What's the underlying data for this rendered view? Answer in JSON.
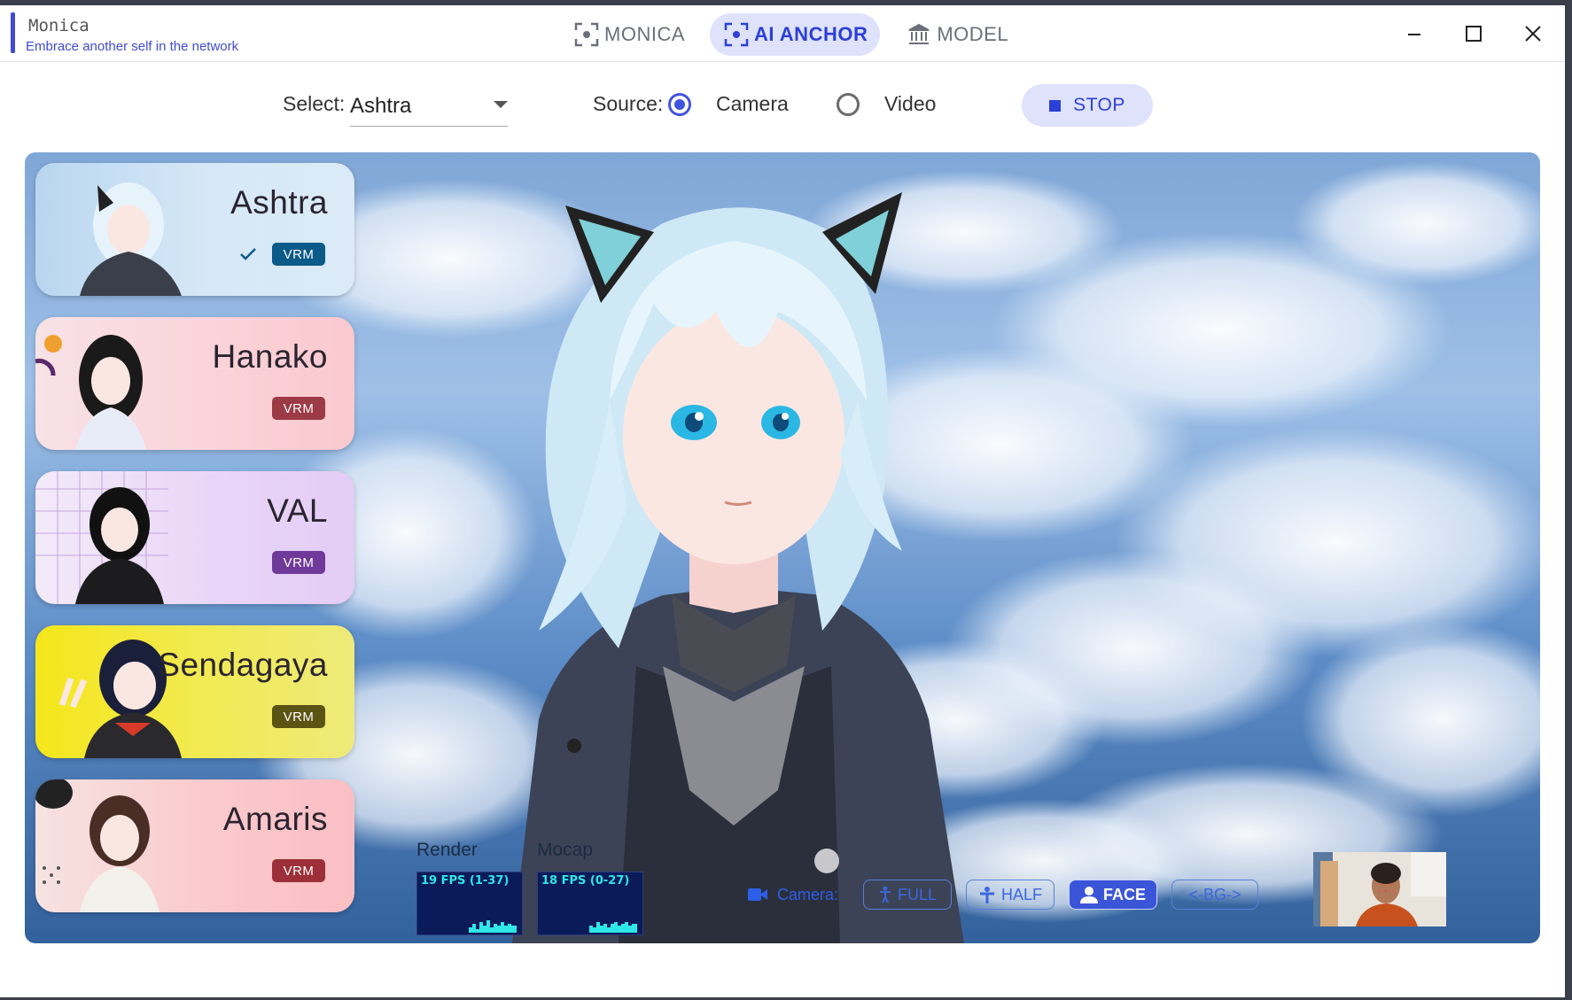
{
  "app": {
    "name": "Monica",
    "tagline": "Embrace another self in the network",
    "accent_color": "#3f4ccf"
  },
  "nav": {
    "tabs": [
      {
        "label": "MONICA",
        "icon": "focus-frame-icon",
        "active": false
      },
      {
        "label": "AI ANCHOR",
        "icon": "focus-frame-icon",
        "active": true
      },
      {
        "label": "MODEL",
        "icon": "bank-icon",
        "active": false
      }
    ]
  },
  "window_controls": {
    "minimize": "minimize-icon",
    "maximize": "maximize-icon",
    "close": "close-icon"
  },
  "toolbar": {
    "select_label": "Select:",
    "select_value": "Ashtra",
    "source_label": "Source:",
    "source_options": [
      {
        "label": "Camera",
        "checked": true
      },
      {
        "label": "Video",
        "checked": false
      }
    ],
    "stop_label": "STOP"
  },
  "models": [
    {
      "name": "Ashtra",
      "badge": "VRM",
      "selected": true,
      "card_color": "#cfe4f6",
      "badge_color": "#0a5a8a"
    },
    {
      "name": "Hanako",
      "badge": "VRM",
      "selected": false,
      "card_color": "#fbd3d8",
      "badge_color": "#9c3a46"
    },
    {
      "name": "VAL",
      "badge": "VRM",
      "selected": false,
      "card_color": "#e9d6f7",
      "badge_color": "#6f3a9a"
    },
    {
      "name": "Sendagaya",
      "badge": "VRM",
      "selected": false,
      "card_color": "#f3ea4a",
      "badge_color": "#5b5412"
    },
    {
      "name": "Amaris",
      "badge": "VRM",
      "selected": false,
      "card_color": "#fbc9cc",
      "badge_color": "#9c2f38"
    }
  ],
  "stats": {
    "render": {
      "label": "Render",
      "fps": "19 FPS (1-37)"
    },
    "mocap": {
      "label": "Mocap",
      "fps": "18 FPS (0-27)"
    }
  },
  "camera_controls": {
    "label": "Camera:",
    "buttons": [
      {
        "label": "FULL",
        "icon": "standing-person-icon",
        "active": false
      },
      {
        "label": "HALF",
        "icon": "half-person-icon",
        "active": false
      },
      {
        "label": "FACE",
        "icon": "person-icon",
        "active": true
      },
      {
        "label": "<-BG->",
        "icon": "",
        "active": false
      }
    ]
  }
}
